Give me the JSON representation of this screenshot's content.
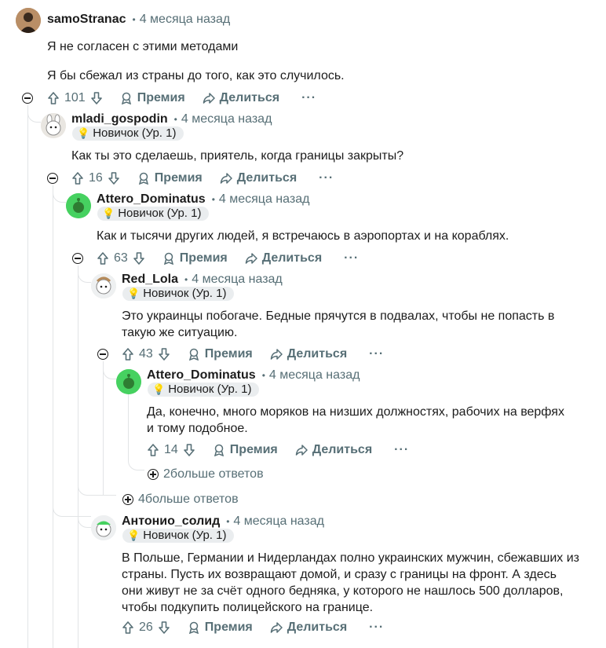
{
  "comments": [
    {
      "username": "samoStranac",
      "separator": "•",
      "time": "4 месяца назад",
      "paragraphs": [
        "Я не согласен с этими методами",
        "Я бы сбежал из страны до того, как это случилось."
      ],
      "score": "101",
      "award_label": "Премия",
      "share_label": "Делиться",
      "more_label": "···"
    },
    {
      "username": "mladi_gospodin",
      "separator": "•",
      "time": "4 месяца назад",
      "flair": "Новичок (Ур. 1)",
      "text": "Как ты это сделаешь, приятель, когда границы закрыты?",
      "score": "16",
      "award_label": "Премия",
      "share_label": "Делиться",
      "more_label": "···"
    },
    {
      "username": "Attero_Dominatus",
      "separator": "•",
      "time": "4 месяца назад",
      "flair": "Новичок (Ур. 1)",
      "text": "Как и тысячи других людей, я встречаюсь в аэропортах и на кораблях.",
      "score": "63",
      "award_label": "Премия",
      "share_label": "Делиться",
      "more_label": "···"
    },
    {
      "username": "Red_Lola",
      "separator": "•",
      "time": "4 месяца назад",
      "flair": "Новичок (Ур. 1)",
      "text": "Это украинцы побогаче. Бедные прячутся в подвалах, чтобы не попасть в такую же ситуацию.",
      "score": "43",
      "award_label": "Премия",
      "share_label": "Делиться",
      "more_label": "···"
    },
    {
      "username": "Attero_Dominatus",
      "separator": "•",
      "time": "4 месяца назад",
      "flair": "Новичок (Ур. 1)",
      "text": "Да, конечно, много моряков на низших должностях, рабочих на верфях и тому подобное.",
      "score": "14",
      "award_label": "Премия",
      "share_label": "Делиться",
      "more_label": "···"
    },
    {
      "username": "Антонио_солид",
      "separator": "•",
      "time": "4 месяца назад",
      "flair": "Новичок (Ур. 1)",
      "text": "В Польше, Германии и Нидерландах полно украинских мужчин, сбежавших из страны. Пусть их возвращают домой, и сразу с границы на фронт. А здесь они живут не за счёт одного бедняка, у которого не нашлось 500 долларов, чтобы подкупить полицейского на границе.",
      "score": "26",
      "award_label": "Премия",
      "share_label": "Делиться",
      "more_label": "···"
    }
  ],
  "more_replies": [
    {
      "label": "2больше ответов"
    },
    {
      "label": "4больше ответов"
    }
  ],
  "colors": {
    "text": "#1c1c1c",
    "meta": "#576f76",
    "thread_line": "#e2e4e6",
    "flair_bg": "#eaedef",
    "green_avatar": "#46d160"
  }
}
